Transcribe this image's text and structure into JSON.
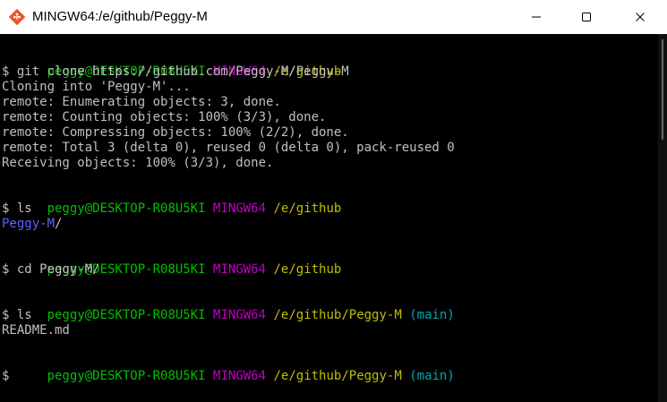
{
  "window": {
    "title": "MINGW64:/e/github/Peggy-M"
  },
  "colors": {
    "user_host": "#00bf00",
    "shell": "#bf00bf",
    "path": "#bfbf00",
    "branch": "#00a6b2",
    "directory": "#6060ff",
    "text": "#c0c0c0",
    "background": "#000000"
  },
  "icons": {
    "app": "git-bash-icon",
    "minimize": "minimize-icon",
    "maximize": "maximize-icon",
    "close": "close-icon"
  },
  "terminal": {
    "prompt1": {
      "user": "peggy@DESKTOP-R08U5KI",
      "shell": "MINGW64",
      "path": "/e/github"
    },
    "cmd1": "$ git clone https://github.com/Peggy-M/Peggy-M",
    "out1": [
      "Cloning into 'Peggy-M'...",
      "remote: Enumerating objects: 3, done.",
      "remote: Counting objects: 100% (3/3), done.",
      "remote: Compressing objects: 100% (2/2), done.",
      "remote: Total 3 (delta 0), reused 0 (delta 0), pack-reused 0",
      "Receiving objects: 100% (3/3), done."
    ],
    "prompt2": {
      "user": "peggy@DESKTOP-R08U5KI",
      "shell": "MINGW64",
      "path": "/e/github"
    },
    "cmd2": "$ ls",
    "out2_dir": "Peggy-M",
    "out2_slash": "/",
    "prompt3": {
      "user": "peggy@DESKTOP-R08U5KI",
      "shell": "MINGW64",
      "path": "/e/github"
    },
    "cmd3": "$ cd Peggy-M/",
    "prompt4": {
      "user": "peggy@DESKTOP-R08U5KI",
      "shell": "MINGW64",
      "path": "/e/github/Peggy-M",
      "branch": "(main)"
    },
    "cmd4": "$ ls",
    "out4": "README.md",
    "prompt5": {
      "user": "peggy@DESKTOP-R08U5KI",
      "shell": "MINGW64",
      "path": "/e/github/Peggy-M",
      "branch": "(main)"
    },
    "cmd5": "$"
  }
}
